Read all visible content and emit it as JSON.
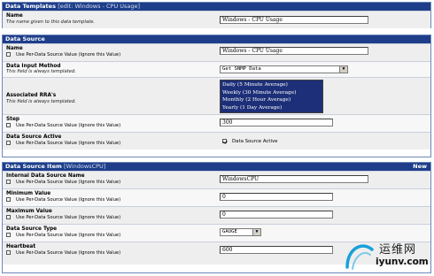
{
  "templates": {
    "title": "Data Templates",
    "subtitle": "[edit: Windows - CPU Usage]",
    "name_label": "Name",
    "name_desc": "The name given to this data template.",
    "name_value": "Windows - CPU Usage"
  },
  "per_value_label": "Use Per-Data Source Value (Ignore this Value)",
  "data_source": {
    "title": "Data Source",
    "name_label": "Name",
    "name_value": "Windows - CPU Usage",
    "input_label": "Data Input Method",
    "input_desc": "This field is always templated.",
    "input_value": "Get SNMP Data",
    "rra_label": "Associated RRA's",
    "rra_desc": "This field is always templated.",
    "rra_options": [
      "Daily (5 Minute Average)",
      "Weekly (30 Minute Average)",
      "Monthly (2 Hour Average)",
      "Yearly (1 Day Average)"
    ],
    "step_label": "Step",
    "step_value": "300",
    "active_label": "Data Source Active",
    "active_check_label": "Data Source Active"
  },
  "ds_item": {
    "title": "Data Source Item",
    "subtitle": "[WindowsCPU]",
    "new_label": "New",
    "internal_label": "Internal Data Source Name",
    "internal_value": "WindowsCPU",
    "min_label": "Minimum Value",
    "min_value": "0",
    "max_label": "Maximum Value",
    "max_value": "0",
    "type_label": "Data Source Type",
    "type_value": "GAUGE",
    "heartbeat_label": "Heartbeat",
    "heartbeat_value": "600"
  },
  "watermark": {
    "brand": "运维网",
    "url": "iyunv.com",
    "colors": {
      "swoosh": "#1aa0d8",
      "text": "#222222"
    }
  }
}
